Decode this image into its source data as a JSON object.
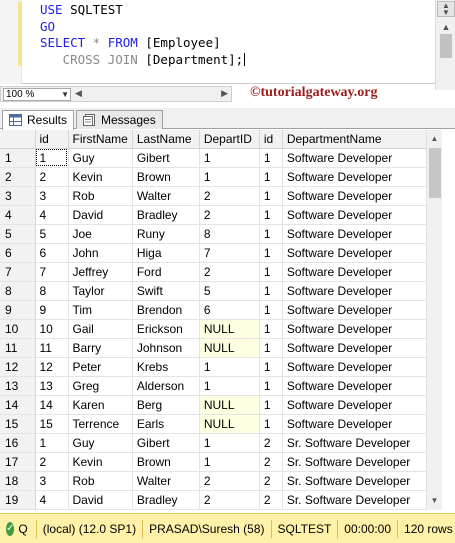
{
  "editor": {
    "line1_kw": "USE",
    "line1_rest": " SQLTEST",
    "line2_kw": "GO",
    "line3_kw1": "SELECT",
    "line3_op": " * ",
    "line3_kw2": "FROM",
    "line3_rest": " [Employee]",
    "line4_kw": "CROSS JOIN",
    "line4_rest": " [Department];"
  },
  "watermark": "©tutorialgateway.org",
  "zoom": {
    "value": "100 %"
  },
  "tabs": [
    {
      "label": "Results",
      "icon": "grid-icon"
    },
    {
      "label": "Messages",
      "icon": "messages-icon"
    }
  ],
  "grid": {
    "columns": [
      "",
      "id",
      "FirstName",
      "LastName",
      "DepartID",
      "id",
      "DepartmentName"
    ],
    "rows": [
      [
        "1",
        "1",
        "Guy",
        "Gibert",
        "1",
        "1",
        "Software Developer"
      ],
      [
        "2",
        "2",
        "Kevin",
        "Brown",
        "1",
        "1",
        "Software Developer"
      ],
      [
        "3",
        "3",
        "Rob",
        "Walter",
        "2",
        "1",
        "Software Developer"
      ],
      [
        "4",
        "4",
        "David",
        "Bradley",
        "2",
        "1",
        "Software Developer"
      ],
      [
        "5",
        "5",
        "Joe",
        "Runy",
        "8",
        "1",
        "Software Developer"
      ],
      [
        "6",
        "6",
        "John",
        "Higa",
        "7",
        "1",
        "Software Developer"
      ],
      [
        "7",
        "7",
        "Jeffrey",
        "Ford",
        "2",
        "1",
        "Software Developer"
      ],
      [
        "8",
        "8",
        "Taylor",
        "Swift",
        "5",
        "1",
        "Software Developer"
      ],
      [
        "9",
        "9",
        "Tim",
        "Brendon",
        "6",
        "1",
        "Software Developer"
      ],
      [
        "10",
        "10",
        "Gail",
        "Erickson",
        "NULL",
        "1",
        "Software Developer"
      ],
      [
        "11",
        "11",
        "Barry",
        "Johnson",
        "NULL",
        "1",
        "Software Developer"
      ],
      [
        "12",
        "12",
        "Peter",
        "Krebs",
        "1",
        "1",
        "Software Developer"
      ],
      [
        "13",
        "13",
        "Greg",
        "Alderson",
        "1",
        "1",
        "Software Developer"
      ],
      [
        "14",
        "14",
        "Karen",
        "Berg",
        "NULL",
        "1",
        "Software Developer"
      ],
      [
        "15",
        "15",
        "Terrence",
        "Earls",
        "NULL",
        "1",
        "Software Developer"
      ],
      [
        "16",
        "1",
        "Guy",
        "Gibert",
        "1",
        "2",
        "Sr. Software Developer"
      ],
      [
        "17",
        "2",
        "Kevin",
        "Brown",
        "1",
        "2",
        "Sr. Software Developer"
      ],
      [
        "18",
        "3",
        "Rob",
        "Walter",
        "2",
        "2",
        "Sr. Software Developer"
      ],
      [
        "19",
        "4",
        "David",
        "Bradley",
        "2",
        "2",
        "Sr. Software Developer"
      ]
    ]
  },
  "status": {
    "icon": "check-icon",
    "query_label": "Q",
    "server": "(local) (12.0 SP1)",
    "user": "PRASAD\\Suresh (58)",
    "database": "SQLTEST",
    "elapsed": "00:00:00",
    "row_count": "120 rows"
  },
  "colors": {
    "keyword": "#1e1ee6",
    "status_bar": "#fff2a8",
    "null_cell": "#ffffe1",
    "watermark": "#9b1c1c"
  }
}
